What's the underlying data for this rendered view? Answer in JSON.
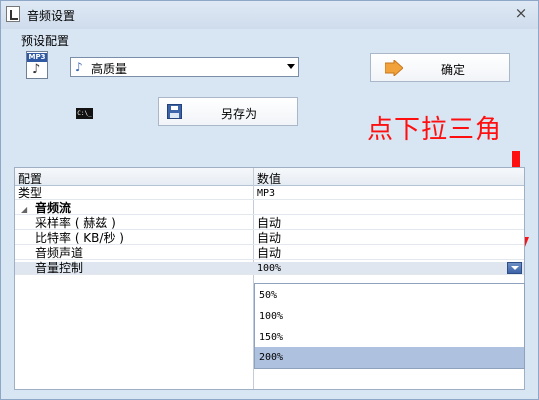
{
  "window": {
    "title": "音频设置",
    "close": "×"
  },
  "preset": {
    "label": "预设配置",
    "file_icon_text": "MP3",
    "combo_value": "高质量",
    "ok_label": "确定",
    "cmd_icon_text": "C:\\_",
    "save_as_label": "另存为"
  },
  "annotation": {
    "text": "点下拉三角",
    "color": "#ff1010"
  },
  "grid": {
    "headers": [
      "配置",
      "数值"
    ],
    "rows": [
      {
        "name": "类型",
        "value": "MP3",
        "kind": "item"
      },
      {
        "name": "音频流",
        "value": "",
        "kind": "group"
      },
      {
        "name": "采样率 ( 赫兹 )",
        "value": "自动",
        "kind": "sub"
      },
      {
        "name": "比特率 ( KB/秒 )",
        "value": "自动",
        "kind": "sub"
      },
      {
        "name": "音频声道",
        "value": "自动",
        "kind": "sub"
      },
      {
        "name": "音量控制",
        "value": "100%",
        "kind": "sub-selected"
      }
    ]
  },
  "dropdown": {
    "options": [
      "50%",
      "100%",
      "150%",
      "200%"
    ],
    "highlighted_index": 3
  }
}
